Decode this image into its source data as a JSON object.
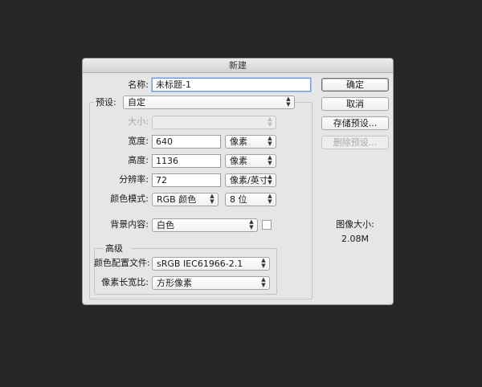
{
  "dialog": {
    "title": "新建"
  },
  "form": {
    "name_label": "名称:",
    "name_value": "未标题-1",
    "preset_label": "预设:",
    "preset_value": "自定",
    "size_label": "大小:",
    "size_value": "",
    "width_label": "宽度:",
    "width_value": "640",
    "width_unit": "像素",
    "height_label": "高度:",
    "height_value": "1136",
    "height_unit": "像素",
    "resolution_label": "分辨率:",
    "resolution_value": "72",
    "resolution_unit": "像素/英寸",
    "color_mode_label": "颜色模式:",
    "color_mode_value": "RGB 颜色",
    "bit_depth_value": "8 位",
    "background_label": "背景内容:",
    "background_value": "白色",
    "background_swatch": "#ffffff"
  },
  "advanced": {
    "title": "高级",
    "color_profile_label": "颜色配置文件:",
    "color_profile_value": "sRGB IEC61966-2.1",
    "pixel_aspect_label": "像素长宽比:",
    "pixel_aspect_value": "方形像素"
  },
  "buttons": {
    "ok": "确定",
    "cancel": "取消",
    "save_preset": "存储预设...",
    "delete_preset": "删除预设..."
  },
  "image_size": {
    "label": "图像大小:",
    "value": "2.08M"
  },
  "icons": {
    "select_arrows": "updown-chevron-icon"
  }
}
